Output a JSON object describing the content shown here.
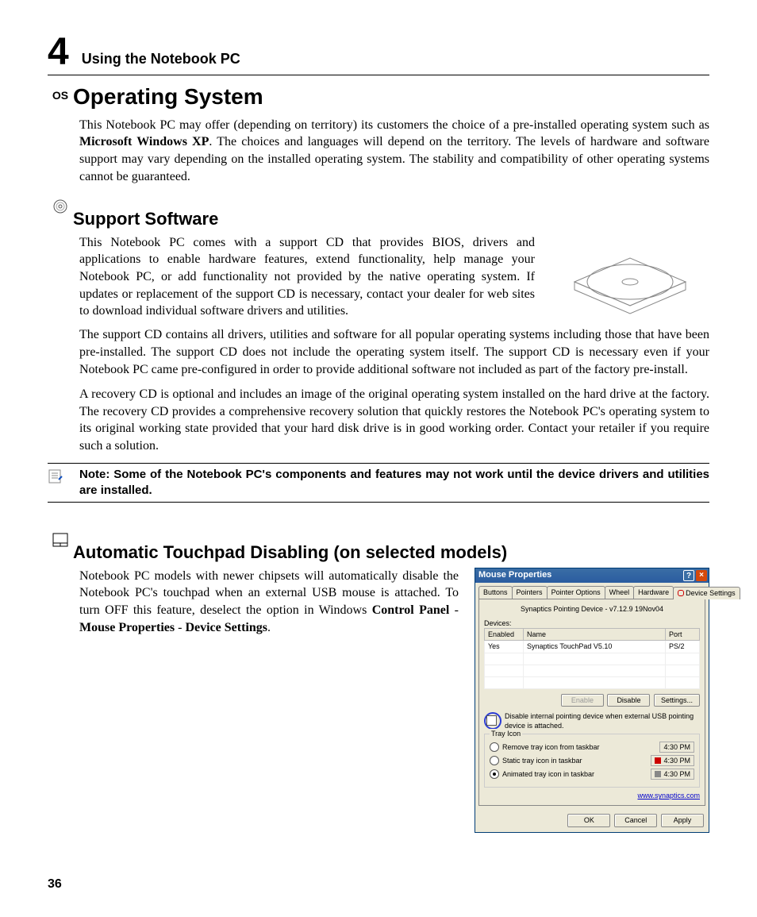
{
  "header": {
    "chapter_number": "4",
    "running_title": "Using the Notebook PC"
  },
  "os_section": {
    "margin": "OS",
    "title": "Operating System",
    "para_pre": "This Notebook PC may offer (depending on territory) its customers the choice of a pre-installed operating system such as ",
    "bold": "Microsoft Windows XP",
    "para_post": ". The choices and languages will depend on the territory. The levels of hardware and software support may vary depending on the installed operating system. The stability and compatibility of other operating systems cannot be guaranteed."
  },
  "support_section": {
    "title": "Support Software",
    "para1": "This Notebook PC comes with a support CD that provides BIOS, drivers and applications to enable hardware features, extend functionality, help manage your Notebook PC, or add functionality not provided by the native operating system. If updates or replacement of the support CD is necessary, contact your dealer for web sites to download individual software drivers and utilities.",
    "para2": "The support CD contains all drivers, utilities and software for all popular operating systems including those that have been pre-installed. The support CD does not include the operating system itself. The support CD is necessary even if your Notebook PC came pre-configured in order to provide additional software not included as part of the factory pre-install.",
    "para3": "A recovery CD is optional and includes an image of the original operating system installed on the hard drive at the factory. The recovery CD provides a comprehensive recovery solution that quickly restores the Notebook PC's operating system to its original working state provided that your hard disk drive is in good working order. Contact your retailer if you require such a solution."
  },
  "note": "Note: Some of the Notebook PC's components and features may not work until the device drivers and utilities are installed.",
  "touchpad_section": {
    "title": "Automatic Touchpad Disabling (on selected models)",
    "para_pre": "Notebook PC models with newer chipsets will automatically disable the Notebook PC's touchpad when an external USB mouse is attached. To turn OFF this feature, deselect the option in Windows ",
    "b1": "Control Panel",
    "sep1": " - ",
    "b2": "Mouse Properties",
    "sep2": " - ",
    "b3": "Device Settings",
    "post": "."
  },
  "window": {
    "title": "Mouse Properties",
    "tabs": [
      "Buttons",
      "Pointers",
      "Pointer Options",
      "Wheel",
      "Hardware",
      "Device Settings"
    ],
    "active_tab": "Device Settings",
    "subhead": "Synaptics Pointing Device - v7.12.9 19Nov04",
    "devices_label": "Devices:",
    "columns": [
      "Enabled",
      "Name",
      "Port"
    ],
    "row": {
      "enabled": "Yes",
      "name": "Synaptics TouchPad V5.10",
      "port": "PS/2"
    },
    "buttons": {
      "enable": "Enable",
      "disable": "Disable",
      "settings": "Settings..."
    },
    "checkbox_label": "isable internal pointing device when external USB pointing device is attached.",
    "tray_label": "Tray Icon",
    "tray1": "Remove tray icon from taskbar",
    "tray2": "Static tray icon in taskbar",
    "tray3": "Animated tray icon in taskbar",
    "time": "4:30 PM",
    "link": "www.synaptics.com",
    "ok": "OK",
    "cancel": "Cancel",
    "apply": "Apply"
  },
  "page_number": "36"
}
